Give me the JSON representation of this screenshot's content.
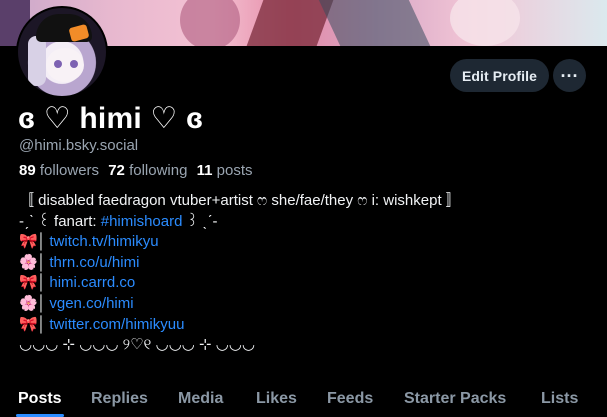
{
  "profile": {
    "display_name": "ɞ ♡ himi ♡ ɞ",
    "handle": "@himi.bsky.social",
    "stats": {
      "followers_count": "89",
      "followers_label": "followers",
      "following_count": "72",
      "following_label": "following",
      "posts_count": "11",
      "posts_label": "posts"
    }
  },
  "actions": {
    "edit_profile": "Edit Profile",
    "more": "···"
  },
  "bio": {
    "line1": "〚 disabled faedragon vtuber+artist ෆ she/fae/they ෆ i: wishkept 〛",
    "line2_prefix": "-ˏˋ ꒰ fanart: ",
    "line2_tag": "#himishoard",
    "line2_suffix": " ꒱ ˎˊ-",
    "links": [
      {
        "emoji": "🎀",
        "sep": "│",
        "text": "twitch.tv/himikyu"
      },
      {
        "emoji": "🌸",
        "sep": "│",
        "text": "thrn.co/u/himi"
      },
      {
        "emoji": "🎀",
        "sep": "│",
        "text": "himi.carrd.co"
      },
      {
        "emoji": "🌸",
        "sep": "│",
        "text": "vgen.co/himi"
      },
      {
        "emoji": "🎀",
        "sep": "│",
        "text": "twitter.com/himikyuu"
      }
    ],
    "footer": "◡◡◡ ⊹ ◡◡◡  ୨♡୧  ◡◡◡ ⊹ ◡◡◡"
  },
  "tabs": [
    "Posts",
    "Replies",
    "Media",
    "Likes",
    "Feeds",
    "Starter Packs",
    "Lists"
  ],
  "colors": {
    "accent": "#2b8cff",
    "background": "#000000",
    "button_bg": "#1e2833",
    "muted_text": "#9aa5b1"
  },
  "icons": {
    "more": "ellipsis-icon"
  }
}
